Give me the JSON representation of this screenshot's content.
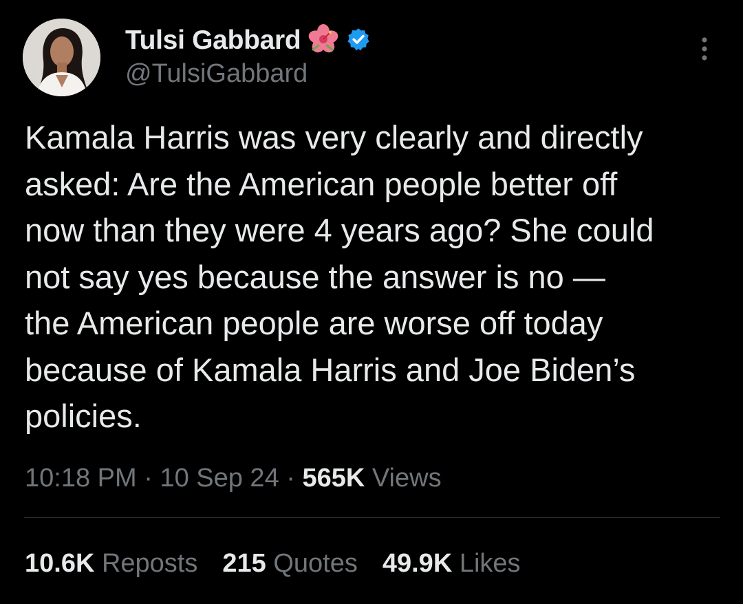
{
  "author": {
    "display_name": "Tulsi Gabbard",
    "handle": "@TulsiGabbard",
    "name_emoji": "hibiscus-flower-icon",
    "verified_badge": "verified-badge-icon",
    "verified_color": "#1d9bf0"
  },
  "tweet": {
    "text": "Kamala Harris was very clearly and directly\nasked: Are the American people better off\nnow than they were 4 years ago? She could\nnot say yes because the answer is no —\nthe American people are worse off today\nbecause of Kamala Harris and Joe Biden’s\npolicies."
  },
  "meta": {
    "time": "10:18 PM",
    "separator1": " · ",
    "date": "10 Sep 24",
    "separator2": " · ",
    "views_count": "565K",
    "views_label": " Views"
  },
  "stats": {
    "reposts_count": "10.6K",
    "reposts_label": " Reposts",
    "quotes_count": "215",
    "quotes_label": " Quotes",
    "likes_count": "49.9K",
    "likes_label": " Likes"
  },
  "colors": {
    "background": "#000000",
    "primary_text": "#e7e9ea",
    "secondary_text": "#71767b",
    "divider": "#2f3336"
  },
  "icons": {
    "more": "more-options-icon"
  }
}
